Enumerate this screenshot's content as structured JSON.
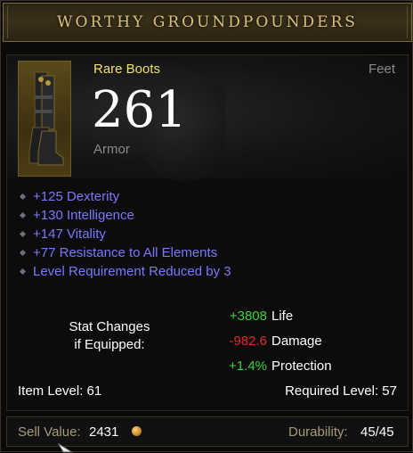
{
  "item": {
    "name": "WORTHY GROUNDPOUNDERS",
    "type": "Rare Boots",
    "slot": "Feet",
    "armor_value": "261",
    "armor_label": "Armor",
    "icon": "boots-icon"
  },
  "affixes": [
    "+125 Dexterity",
    "+130 Intelligence",
    "+147 Vitality",
    "+77 Resistance to All Elements",
    "Level Requirement Reduced by 3"
  ],
  "stat_changes": {
    "label_line1": "Stat Changes",
    "label_line2": "if Equipped:",
    "rows": [
      {
        "value": "+3808",
        "name": "Life",
        "color": "#3cd23c"
      },
      {
        "value": "-982.6",
        "name": "Damage",
        "color": "#e02a2a"
      },
      {
        "value": "+1.4%",
        "name": "Protection",
        "color": "#3cd23c"
      }
    ]
  },
  "levels": {
    "item_level": "Item Level: 61",
    "required_level": "Required Level: 57"
  },
  "footer": {
    "sell_label": "Sell Value:",
    "sell_amount": "2431",
    "durability_label": "Durability:",
    "durability_value": "45/45"
  },
  "colors": {
    "title_gold": "#d8c27a",
    "rare_yellow": "#f0e070",
    "affix_blue": "#7a78ff",
    "gain_green": "#3cd23c",
    "loss_red": "#e02a2a"
  }
}
